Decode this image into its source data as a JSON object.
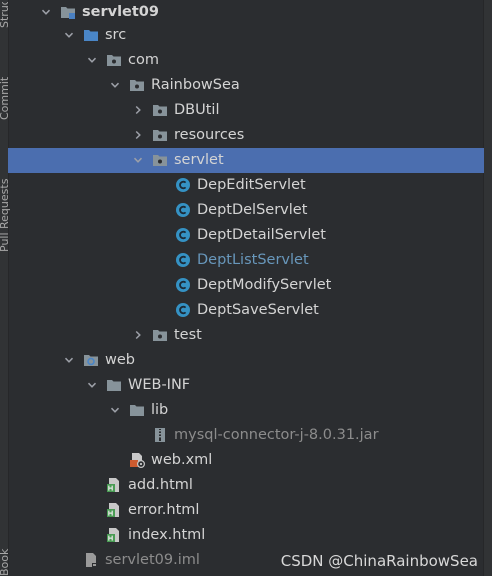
{
  "sidebar": {
    "tabs": [
      "Structure",
      "Commit",
      "Pull Requests",
      "Bookmarks"
    ]
  },
  "tree": {
    "rows": [
      {
        "label": "servlet09",
        "icon": "module-folder-icon",
        "expanded": true,
        "bold": true
      },
      {
        "label": "src",
        "icon": "source-folder-icon",
        "expanded": true
      },
      {
        "label": "com",
        "icon": "package-icon",
        "expanded": true
      },
      {
        "label": "RainbowSea",
        "icon": "package-icon",
        "expanded": true
      },
      {
        "label": "DBUtil",
        "icon": "package-icon",
        "expanded": false
      },
      {
        "label": "resources",
        "icon": "package-icon",
        "expanded": false
      },
      {
        "label": "servlet",
        "icon": "package-icon",
        "expanded": true,
        "selected": true
      },
      {
        "label": "DepEditServlet",
        "icon": "class-icon"
      },
      {
        "label": "DeptDelServlet",
        "icon": "class-icon"
      },
      {
        "label": "DeptDetailServlet",
        "icon": "class-icon"
      },
      {
        "label": "DeptListServlet",
        "icon": "class-icon",
        "link": true
      },
      {
        "label": "DeptModifyServlet",
        "icon": "class-icon"
      },
      {
        "label": "DeptSaveServlet",
        "icon": "class-icon"
      },
      {
        "label": "test",
        "icon": "package-icon",
        "expanded": false
      },
      {
        "label": "web",
        "icon": "web-folder-icon",
        "expanded": true
      },
      {
        "label": "WEB-INF",
        "icon": "folder-icon",
        "expanded": true
      },
      {
        "label": "lib",
        "icon": "folder-icon",
        "expanded": true
      },
      {
        "label": "mysql-connector-j-8.0.31.jar",
        "icon": "jar-icon",
        "library": true
      },
      {
        "label": "web.xml",
        "icon": "xml-config-icon"
      },
      {
        "label": "add.html",
        "icon": "html-file-icon"
      },
      {
        "label": "error.html",
        "icon": "html-file-icon"
      },
      {
        "label": "index.html",
        "icon": "html-file-icon"
      },
      {
        "label": "servlet09.iml",
        "icon": "iml-file-icon",
        "muted": true
      }
    ]
  },
  "watermark": "CSDN @ChinaRainbowSea",
  "colors": {
    "background": "#2b2d30",
    "selection": "#4b6eaf",
    "text": "#d4d4d4",
    "link": "#6897bb",
    "library": "#8c8c8c",
    "class_icon": "#3592c4",
    "html_icon": "#499c54"
  }
}
